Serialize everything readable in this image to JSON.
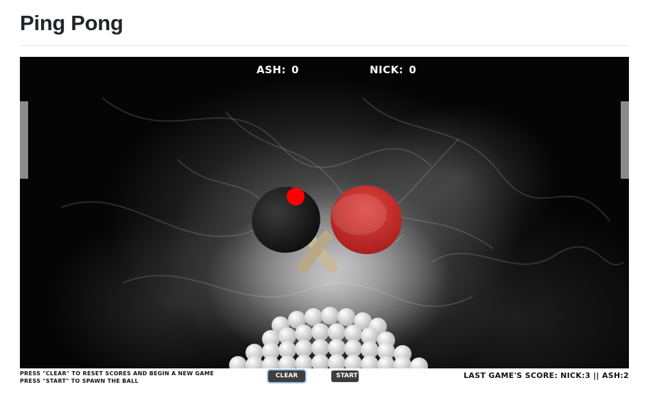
{
  "page": {
    "title": "Ping Pong"
  },
  "scoreboard": {
    "ash_label": "ASH:",
    "ash_score": "0",
    "nick_label": "NICK:",
    "nick_score": "0"
  },
  "controls": {
    "help_line_1": "PRESS \"CLEAR\" TO RESET SCORES AND BEGIN A NEW GAME",
    "help_line_2": "PRESS \"START\" TO SPAWN THE BALL",
    "clear_label": "CLEAR",
    "start_label": "START",
    "last_game_score": "LAST GAME'S SCORE: NICK:3 || ASH:2"
  },
  "colors": {
    "ball": "#ff0000",
    "paddle": "#8b8b8b",
    "court_background": "#050505",
    "button_background": "#3e3e3e",
    "black_bat": "#141414",
    "red_bat": "#c62828"
  },
  "icons": {
    "background_art": "crossed-ping-pong-bats-icon",
    "ball_pile": "ball-pile-icon"
  }
}
